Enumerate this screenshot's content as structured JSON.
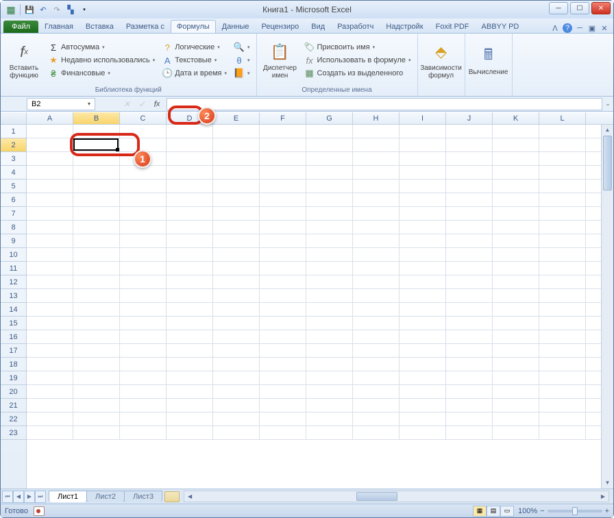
{
  "title": "Книга1 - Microsoft Excel",
  "tabs": {
    "file": "Файл",
    "items": [
      "Главная",
      "Вставка",
      "Разметка с",
      "Формулы",
      "Данные",
      "Рецензиро",
      "Вид",
      "Разработч",
      "Надстройк",
      "Foxit PDF",
      "ABBYY PD"
    ],
    "active_index": 3
  },
  "ribbon": {
    "insert_fn": {
      "label": "Вставить функцию",
      "icon": "fx"
    },
    "lib": {
      "autosum": "Автосумма",
      "recent": "Недавно использовались",
      "financial": "Финансовые",
      "logical": "Логические",
      "text": "Текстовые",
      "datetime": "Дата и время",
      "label": "Библиотека функций"
    },
    "names": {
      "manager": "Диспетчер имен",
      "define": "Присвоить имя",
      "use": "Использовать в формуле",
      "create": "Создать из выделенного",
      "label": "Определенные имена"
    },
    "deps": "Зависимости формул",
    "calc": "Вычисление"
  },
  "namebox": "B2",
  "columns": [
    "A",
    "B",
    "C",
    "D",
    "E",
    "F",
    "G",
    "H",
    "I",
    "J",
    "K",
    "L"
  ],
  "rows": [
    "1",
    "2",
    "3",
    "4",
    "5",
    "6",
    "7",
    "8",
    "9",
    "10",
    "11",
    "12",
    "13",
    "14",
    "15",
    "16",
    "17",
    "18",
    "19",
    "20",
    "21",
    "22",
    "23"
  ],
  "selected": {
    "col": 1,
    "row": 1
  },
  "sheets": {
    "items": [
      "Лист1",
      "Лист2",
      "Лист3"
    ],
    "active": 0
  },
  "status": "Готово",
  "zoom": "100%",
  "annotations": {
    "b1": "1",
    "b2": "2"
  }
}
